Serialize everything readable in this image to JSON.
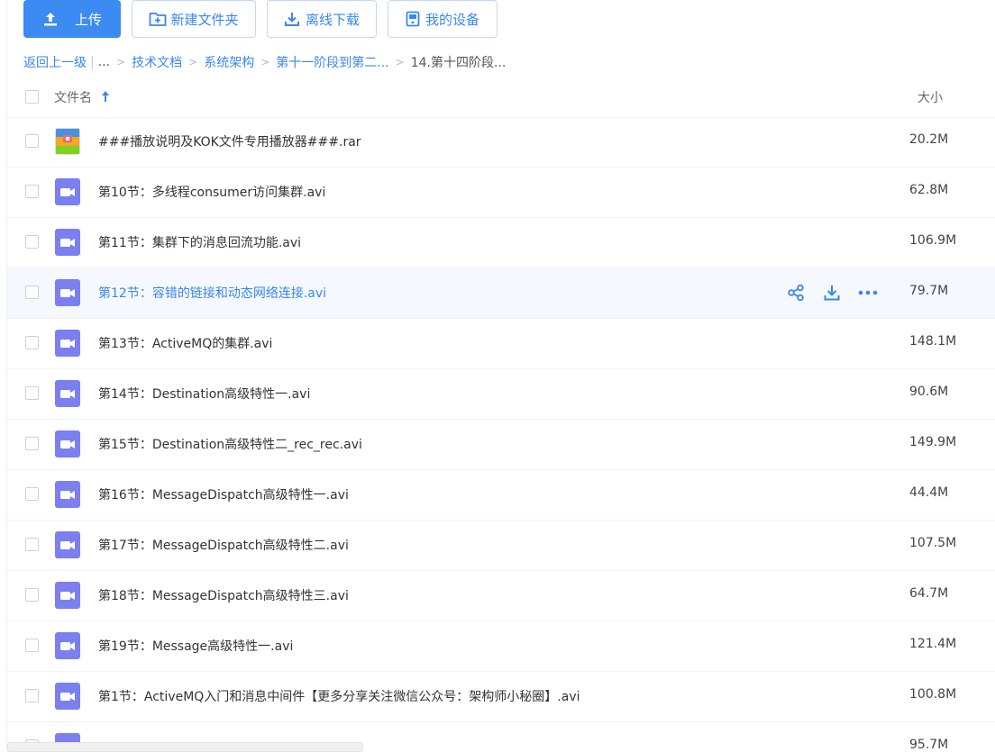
{
  "toolbar": {
    "upload_label": "上传",
    "newfolder_label": "新建文件夹",
    "offline_label": "离线下载",
    "devices_label": "我的设备"
  },
  "breadcrumb": {
    "back": "返回上一级",
    "ellipsis": "...",
    "items": [
      "技术文档",
      "系统架构",
      "第十一阶段到第二..."
    ],
    "current": "14.第十四阶段..."
  },
  "header": {
    "name_label": "文件名",
    "size_label": "大小"
  },
  "colors": {
    "accent": "#3b8bf2",
    "video_icon": "#7b7ff0"
  },
  "files": [
    {
      "name": "###播放说明及KOK文件专用播放器###.rar",
      "size": "20.2M",
      "type": "rar-archive-icon"
    },
    {
      "name": "第10节：多线程consumer访问集群.avi",
      "size": "62.8M",
      "type": "video-file-icon"
    },
    {
      "name": "第11节：集群下的消息回流功能.avi",
      "size": "106.9M",
      "type": "video-file-icon"
    },
    {
      "name": "第12节：容错的链接和动态网络连接.avi",
      "size": "79.7M",
      "type": "video-file-icon"
    },
    {
      "name": "第13节：ActiveMQ的集群.avi",
      "size": "148.1M",
      "type": "video-file-icon"
    },
    {
      "name": "第14节：Destination高级特性一.avi",
      "size": "90.6M",
      "type": "video-file-icon"
    },
    {
      "name": "第15节：Destination高级特性二_rec_rec.avi",
      "size": "149.9M",
      "type": "video-file-icon"
    },
    {
      "name": "第16节：MessageDispatch高级特性一.avi",
      "size": "44.4M",
      "type": "video-file-icon"
    },
    {
      "name": "第17节：MessageDispatch高级特性二.avi",
      "size": "107.5M",
      "type": "video-file-icon"
    },
    {
      "name": "第18节：MessageDispatch高级特性三.avi",
      "size": "64.7M",
      "type": "video-file-icon"
    },
    {
      "name": "第19节：Message高级特性一.avi",
      "size": "121.4M",
      "type": "video-file-icon"
    },
    {
      "name": "第1节：ActiveMQ入门和消息中间件【更多分享关注微信公众号：架构师小秘圈】.avi",
      "size": "100.8M",
      "type": "video-file-icon"
    },
    {
      "name": "",
      "size": "95.7M",
      "type": "video-file-icon"
    }
  ]
}
